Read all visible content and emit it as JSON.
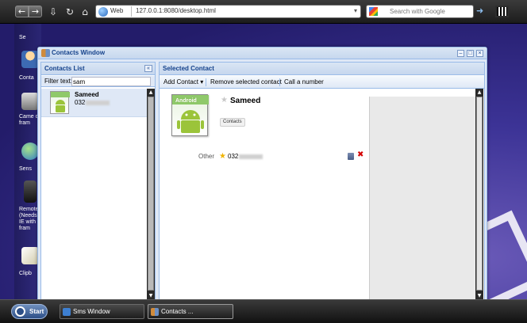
{
  "browser": {
    "url_scheme_label": "Web",
    "url": "127.0.0.1:8080/desktop.html",
    "search_placeholder": "Search with Google"
  },
  "desktop": {
    "icon_labels": [
      "Se",
      "Conta",
      "Came only s fram",
      "Sens",
      "Remote (Needs and IE with s fram",
      "Clipb"
    ]
  },
  "window": {
    "title": "Contacts Window",
    "left_panel": {
      "title": "Contacts List",
      "filter_label": "Filter text:",
      "filter_value": "sam",
      "contacts": [
        {
          "name": "Sameed",
          "phone": "032"
        }
      ]
    },
    "right_panel": {
      "title": "Selected Contact",
      "toolbar": {
        "add_contact": "Add Contact",
        "remove_contact": "Remove selected contact",
        "call_number": "Call a number"
      },
      "contact": {
        "avatar_text": "Android",
        "name": "Sameed",
        "group_tag": "Contacts",
        "phone_type": "Other",
        "phone": "032"
      }
    }
  },
  "taskbar": {
    "start_label": "Start",
    "tasks": [
      {
        "label": "Sms Window"
      },
      {
        "label": "Contacts ..."
      }
    ]
  },
  "colors": {
    "panel_title": "#15428b",
    "panel_border": "#99bbe8",
    "selected_row": "#dfe8f6",
    "delete": "#d40000",
    "favorite_star": "#f0b400"
  }
}
